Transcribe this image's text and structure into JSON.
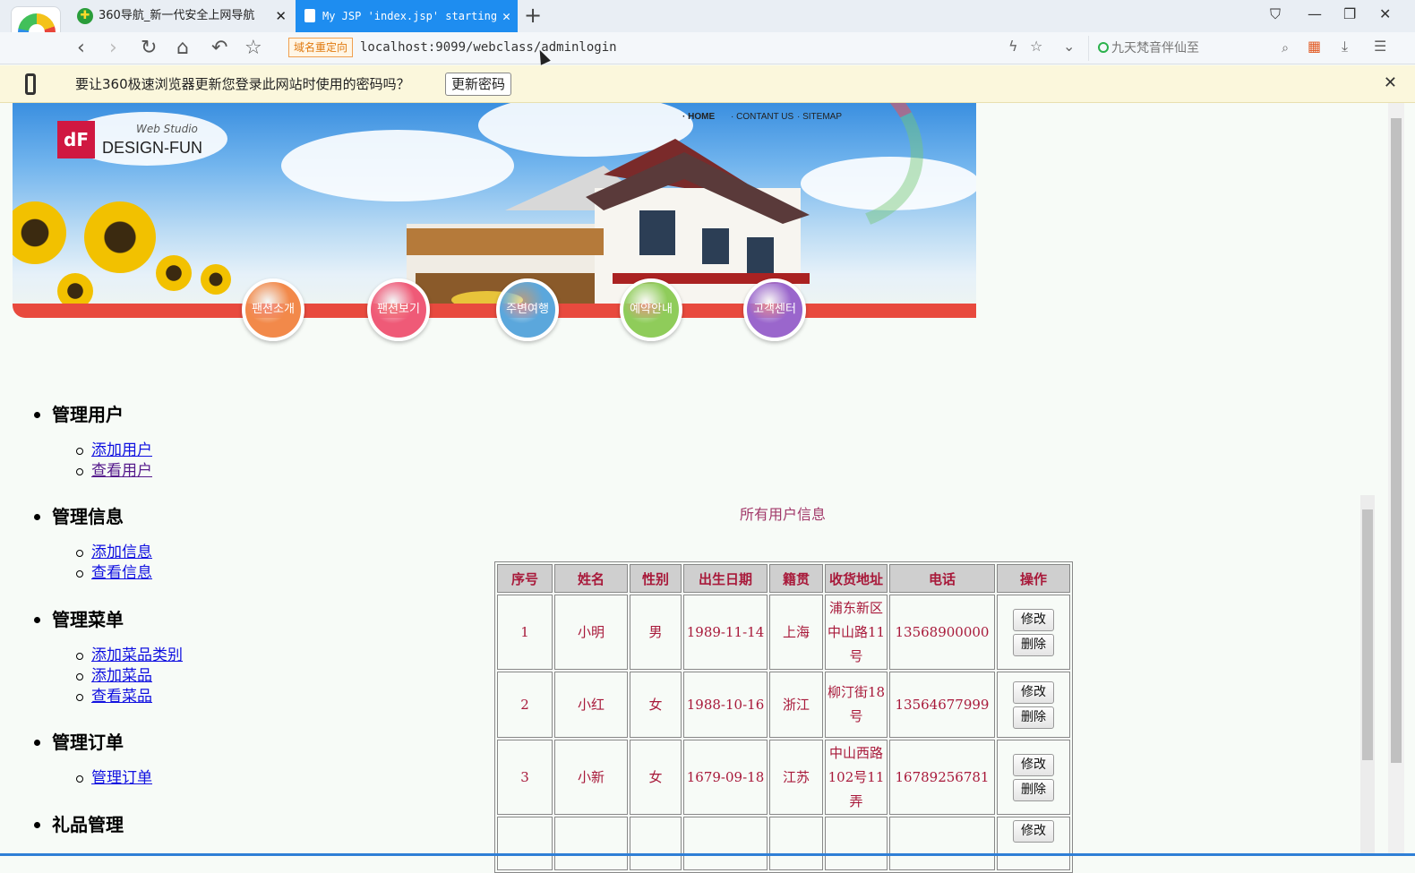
{
  "browser": {
    "tabs": [
      {
        "title": "360导航_新一代安全上网导航"
      },
      {
        "title": "My JSP 'index.jsp' starting"
      }
    ],
    "redirect_badge": "域名重定向",
    "url": "localhost:9099/webclass/adminlogin",
    "search_placeholder": "九天梵音伴仙至",
    "password_prompt": "要让360极速浏览器更新您登录此网站时使用的密码吗？",
    "update_button": "更新密码"
  },
  "banner": {
    "brand_sub": "Web Studio",
    "brand_main": "DESIGN-FUN",
    "top_nav": [
      "· HOME",
      "· CONTANT US",
      "· SITEMAP"
    ],
    "circles": [
      {
        "label": "팬션소개",
        "color": "#f2894a"
      },
      {
        "label": "팬션보기",
        "color": "#ef5a77"
      },
      {
        "label": "주변여행",
        "color": "#5ba7dc"
      },
      {
        "label": "예약안내",
        "color": "#8fcc5a"
      },
      {
        "label": "고객센터",
        "color": "#9a66cc"
      }
    ]
  },
  "menu": [
    {
      "heading": "管理用户",
      "links": [
        "添加用户",
        "查看用户"
      ]
    },
    {
      "heading": "管理信息",
      "links": [
        "添加信息",
        "查看信息"
      ]
    },
    {
      "heading": "管理菜单",
      "links": [
        "添加菜品类别",
        "添加菜品",
        "查看菜品"
      ]
    },
    {
      "heading": "管理订单",
      "links": [
        "管理订单"
      ]
    },
    {
      "heading": "礼品管理",
      "links": []
    }
  ],
  "table": {
    "title": "所有用户信息",
    "headers": [
      "序号",
      "姓名",
      "性别",
      "出生日期",
      "籍贯",
      "收货地址",
      "电话",
      "操作"
    ],
    "edit_label": "修改",
    "delete_label": "删除",
    "rows": [
      {
        "no": "1",
        "name": "小明",
        "gender": "男",
        "birth": "1989-11-14",
        "origin": "上海",
        "address": "浦东新区中山路11号",
        "phone": "13568900000"
      },
      {
        "no": "2",
        "name": "小红",
        "gender": "女",
        "birth": "1988-10-16",
        "origin": "浙江",
        "address": "柳汀街18号",
        "phone": "13564677999"
      },
      {
        "no": "3",
        "name": "小新",
        "gender": "女",
        "birth": "1679-09-18",
        "origin": "江苏",
        "address": "中山西路102号11弄",
        "phone": "16789256781"
      },
      {
        "no": "",
        "name": "",
        "gender": "",
        "birth": "",
        "origin": "",
        "address": "",
        "phone": ""
      }
    ]
  }
}
